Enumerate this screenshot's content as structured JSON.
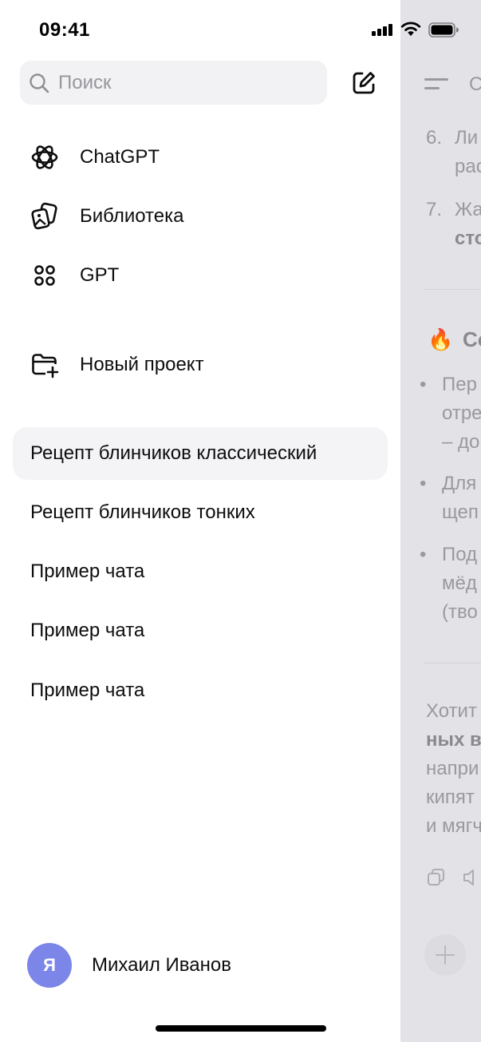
{
  "status_bar": {
    "time": "09:41"
  },
  "search": {
    "placeholder": "Поиск"
  },
  "nav": {
    "items": [
      {
        "label": "ChatGPT",
        "icon": "openai-logo-icon"
      },
      {
        "label": "Библиотека",
        "icon": "library-icon"
      },
      {
        "label": "GPT",
        "icon": "gpts-grid-icon"
      }
    ],
    "new_project_label": "Новый проект"
  },
  "chats": [
    {
      "label": "Рецепт блинчиков классический",
      "active": true
    },
    {
      "label": "Рецепт блинчиков тонких",
      "active": false
    },
    {
      "label": "Пример чата",
      "active": false
    },
    {
      "label": "Пример чата",
      "active": false
    },
    {
      "label": "Пример чата",
      "active": false
    }
  ],
  "user": {
    "initial": "Я",
    "name": "Михаил Иванов",
    "avatar_color": "#7b86e8"
  },
  "background_chat": {
    "title_fragment": "С",
    "lines": [
      {
        "num": "6.",
        "text": "Ли"
      },
      {
        "text": "рас"
      },
      {
        "num": "7.",
        "text": "Жа"
      },
      {
        "text": "сто"
      },
      {
        "text": "Со"
      },
      {
        "bullet": "•",
        "text": "Пер"
      },
      {
        "text": "отре"
      },
      {
        "text": "– до"
      },
      {
        "bullet": "•",
        "text": "Для"
      },
      {
        "text": "щеп"
      },
      {
        "bullet": "•",
        "text": "Под"
      },
      {
        "text": "мёд"
      },
      {
        "text": "(тво"
      },
      {
        "text": "Хотит"
      },
      {
        "text": "ных в"
      },
      {
        "text": "напри"
      },
      {
        "text": "кипят"
      },
      {
        "text": "и мягч"
      }
    ]
  },
  "colors": {
    "sidebar_bg": "#ffffff",
    "dimmed_panel": "#e3e2e6",
    "active_chat_bg": "#f4f3f6",
    "search_bg": "#f2f1f4"
  }
}
